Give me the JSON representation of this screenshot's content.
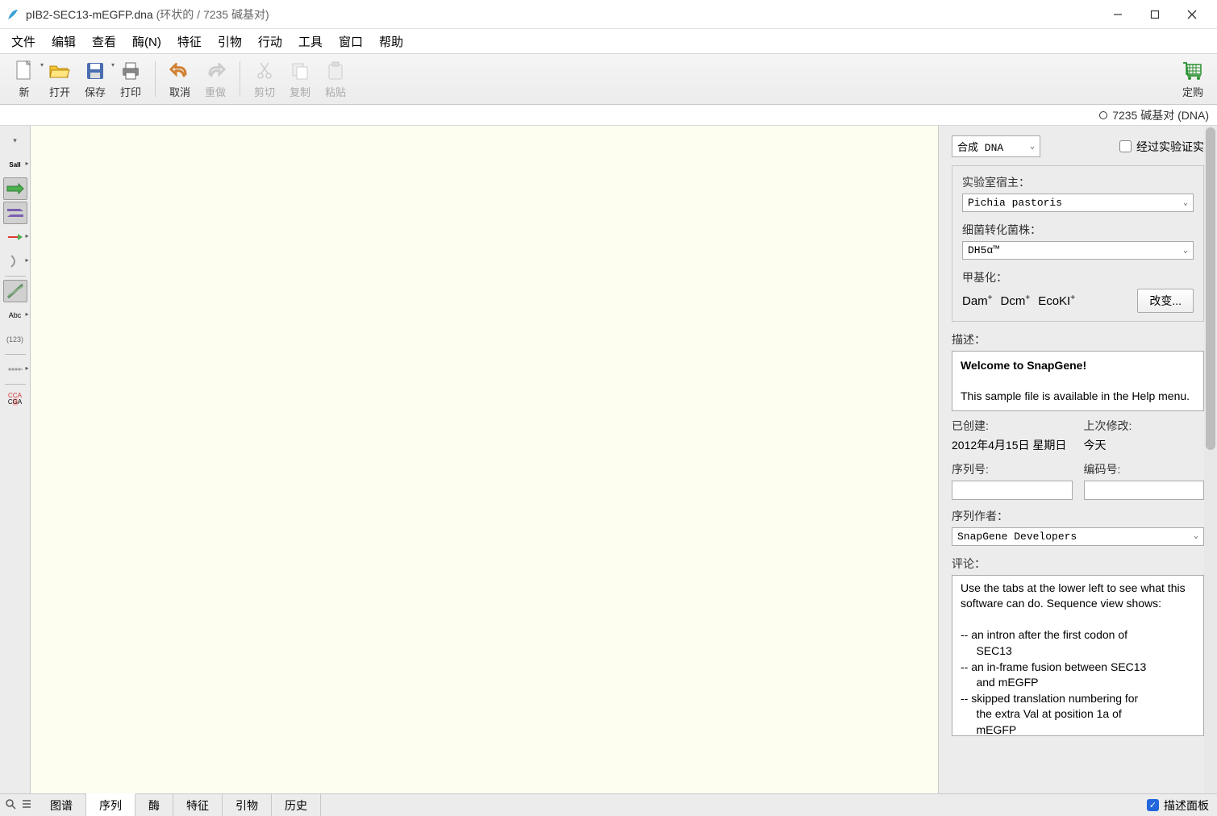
{
  "titlebar": {
    "filename": "pIB2-SEC13-mEGFP.dna",
    "subtitle": "(环状的 / 7235 碱基对)"
  },
  "menubar": [
    "文件",
    "编辑",
    "查看",
    "酶(N)",
    "特征",
    "引物",
    "行动",
    "工具",
    "窗口",
    "帮助"
  ],
  "toolbar": {
    "new": "新",
    "open": "打开",
    "save": "保存",
    "print": "打印",
    "undo": "取消",
    "redo": "重做",
    "cut": "剪切",
    "copy": "复制",
    "paste": "粘贴",
    "order": "定购"
  },
  "infobar": {
    "text": "7235 碱基对  (DNA)"
  },
  "rightPanel": {
    "dnaType": "合成 DNA",
    "verified": "经过实验证实",
    "hostLabel": "实验室宿主：",
    "hostValue": "Pichia pastoris",
    "strainLabel": "细菌转化菌株：",
    "strainValue": "DH5α™",
    "methylLabel": "甲基化：",
    "methylDam": "Dam",
    "methylDcm": "Dcm",
    "methylEco": "EcoKI",
    "changeBtn": "改变...",
    "descLabel": "描述：",
    "descTitle": "Welcome to SnapGene!",
    "descBody": "This sample file is available in the Help menu.",
    "createdLabel": "已创建:",
    "createdValue": "2012年4月15日  星期日",
    "modifiedLabel": "上次修改:",
    "modifiedValue": "今天",
    "seqNumLabel": "序列号:",
    "codeNumLabel": "编码号:",
    "authorLabel": "序列作者：",
    "authorValue": "SnapGene Developers",
    "commentLabel": "评论：",
    "commentBody": "Use the tabs at the lower left to see what this software can do. Sequence view shows:\n\n-- an intron after the first codon of\n     SEC13\n-- an in-frame fusion between SEC13\n     and mEGFP\n-- skipped translation numbering for\n     the extra Val at position 1a of\n     mEGFP"
  },
  "bottombar": {
    "tabs": [
      "图谱",
      "序列",
      "酶",
      "特征",
      "引物",
      "历史"
    ],
    "activeTab": 1,
    "descPanel": "描述面板"
  }
}
